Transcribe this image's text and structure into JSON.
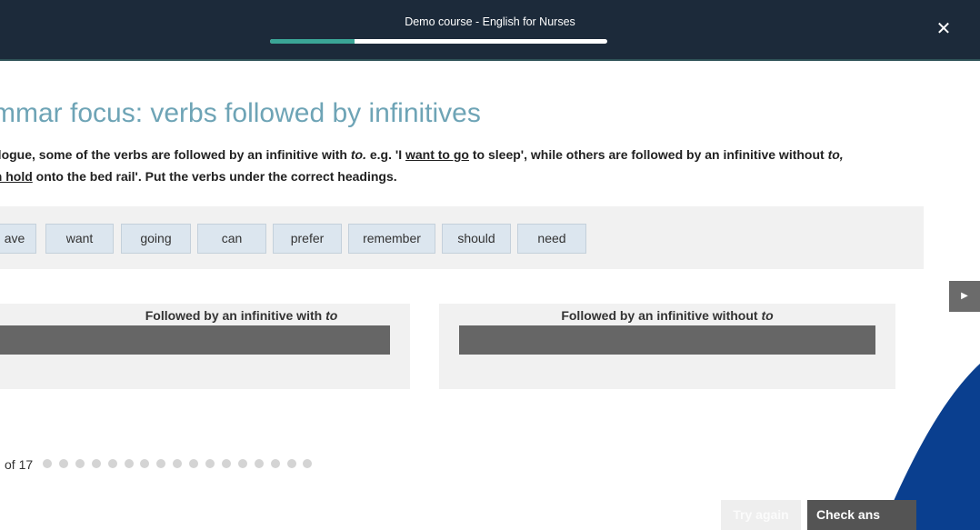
{
  "header": {
    "course_title": "Demo course - English for Nurses",
    "progress": 0.25,
    "close_icon": "close-icon"
  },
  "main": {
    "heading": "mmar focus: verbs followed by infinitives",
    "instructions": {
      "line1_a": "ialogue, some of the verbs are followed by an infinitive with ",
      "line1_to": "to.",
      "line1_b": " e.g. 'I ",
      "line1_link": "want to go",
      "line1_c": " to sleep', while others are followed by an infinitive without ",
      "line1_to2": "to,",
      "line2_link": "an hold",
      "line2_rest": " onto the bed rail'. Put the verbs under the correct headings."
    },
    "word_bank": [
      "ave",
      "want",
      "going",
      "can",
      "prefer",
      "remember",
      "should",
      "need"
    ],
    "drop_panels": [
      {
        "label": "Followed by an infinitive with ",
        "label_em": "to"
      },
      {
        "label": "Followed by an infinitive without ",
        "label_em": "to"
      }
    ],
    "next_icon": "next-arrow-icon"
  },
  "footer": {
    "page_counter": "of 17",
    "dot_count": 17,
    "try_again": "Try again",
    "check_answer": "Check ans"
  },
  "colors": {
    "topbar": "#1c2a3a",
    "progress": "#3aa596",
    "heading": "#6ea4b6",
    "chip": "#dce6ef",
    "accent_shape": "#0a3f8f"
  }
}
